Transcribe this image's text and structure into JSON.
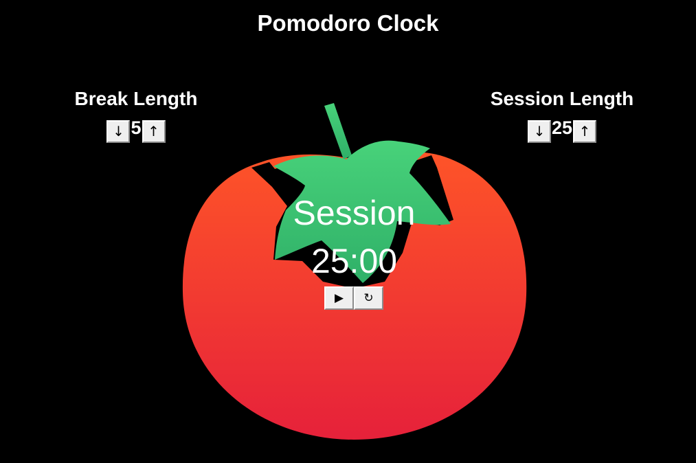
{
  "app": {
    "title": "Pomodoro Clock"
  },
  "break": {
    "label": "Break Length",
    "value": "5",
    "decrement_icon": "↓",
    "increment_icon": "↑"
  },
  "session": {
    "label": "Session Length",
    "value": "25",
    "decrement_icon": "↓",
    "increment_icon": "↑"
  },
  "timer": {
    "label": "Session",
    "time": "25:00",
    "start_stop_icon": "▶",
    "reset_icon": "↻"
  },
  "colors": {
    "background": "#000000",
    "tomato_top": "#fe5428",
    "tomato_bottom": "#e6213a",
    "leaf_top": "#48d27a",
    "leaf_bottom": "#2fb068",
    "text": "#ffffff"
  }
}
